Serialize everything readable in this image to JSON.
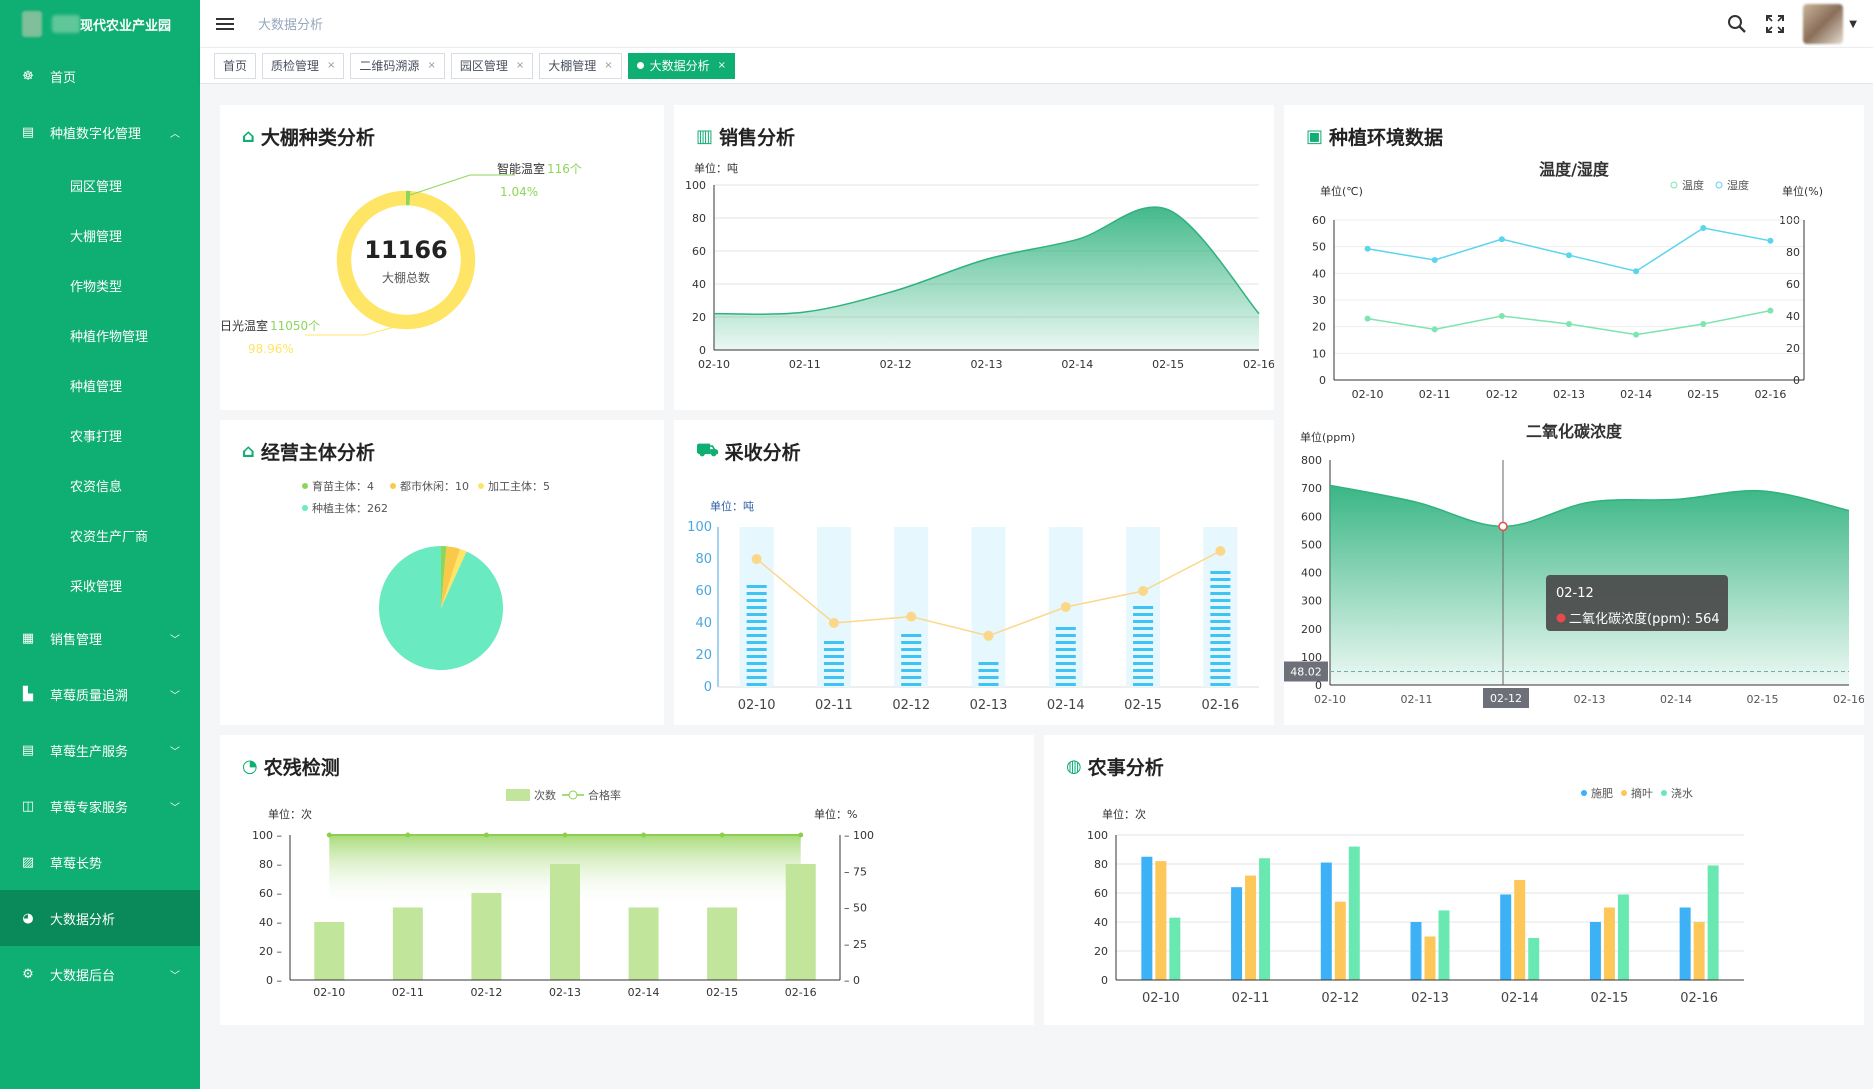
{
  "brand": {
    "name": "现代农业产业园"
  },
  "sidebar": {
    "items": [
      {
        "icon": "dashboard-icon",
        "glyph": "☸",
        "label": "首页",
        "type": "item"
      },
      {
        "icon": "grid-icon",
        "glyph": "▤",
        "label": "种植数字化管理",
        "type": "item",
        "arrow": "︿"
      },
      {
        "label": "园区管理",
        "type": "sub"
      },
      {
        "label": "大棚管理",
        "type": "sub"
      },
      {
        "label": "作物类型",
        "type": "sub"
      },
      {
        "label": "种植作物管理",
        "type": "sub"
      },
      {
        "label": "种植管理",
        "type": "sub"
      },
      {
        "label": "农事打理",
        "type": "sub"
      },
      {
        "label": "农资信息",
        "type": "sub"
      },
      {
        "label": "农资生产厂商",
        "type": "sub"
      },
      {
        "label": "采收管理",
        "type": "sub"
      },
      {
        "icon": "table-icon",
        "glyph": "▦",
        "label": "销售管理",
        "type": "item",
        "arrow": "﹀"
      },
      {
        "icon": "document-icon",
        "glyph": "▙",
        "label": "草莓质量追溯",
        "type": "item",
        "arrow": "﹀"
      },
      {
        "icon": "grid-icon",
        "glyph": "▤",
        "label": "草莓生产服务",
        "type": "item",
        "arrow": "﹀"
      },
      {
        "icon": "book-icon",
        "glyph": "◫",
        "label": "草莓专家服务",
        "type": "item",
        "arrow": "﹀"
      },
      {
        "icon": "chart-icon",
        "glyph": "▨",
        "label": "草莓长势",
        "type": "item"
      },
      {
        "icon": "globe-icon",
        "glyph": "◕",
        "label": "大数据分析",
        "type": "item",
        "active": true
      },
      {
        "icon": "gear-icon",
        "glyph": "⚙",
        "label": "大数据后台",
        "type": "item",
        "arrow": "﹀"
      }
    ]
  },
  "header": {
    "breadcrumb": "大数据分析"
  },
  "tabs": [
    {
      "label": "首页",
      "closable": false
    },
    {
      "label": "质检管理",
      "closable": true
    },
    {
      "label": "二维码溯源",
      "closable": true
    },
    {
      "label": "园区管理",
      "closable": true
    },
    {
      "label": "大棚管理",
      "closable": true
    },
    {
      "label": "大数据分析",
      "closable": true,
      "active": true
    }
  ],
  "cards": {
    "greenhouse": {
      "title": "大棚种类分析"
    },
    "sales": {
      "title": "销售分析"
    },
    "env": {
      "title": "种植环境数据"
    },
    "business": {
      "title": "经营主体分析"
    },
    "harvest": {
      "title": "采收分析"
    },
    "pesticide": {
      "title": "农残检测"
    },
    "farming": {
      "title": "农事分析"
    }
  },
  "chart_data": [
    {
      "id": "greenhouse",
      "type": "pie",
      "center_value": "11166",
      "center_label": "大棚总数",
      "slices": [
        {
          "name": "智能温室",
          "value": 116,
          "value_label": "116个",
          "percent": "1.04%",
          "color": "#8dd65a"
        },
        {
          "name": "日光温室",
          "value": 11050,
          "value_label": "11050个",
          "percent": "98.96%",
          "color": "#ffe566"
        }
      ]
    },
    {
      "id": "sales",
      "type": "area",
      "unit": "单位：吨",
      "x": [
        "02-10",
        "02-11",
        "02-12",
        "02-13",
        "02-14",
        "02-15",
        "02-16"
      ],
      "values": [
        22,
        23,
        36,
        55,
        67,
        85,
        22
      ],
      "ylim": [
        0,
        100
      ],
      "color": "#2fb27e"
    },
    {
      "id": "temp_hum",
      "type": "line",
      "title": "温度/湿度",
      "y_left_label": "单位(℃)",
      "y_right_label": "单位(%)",
      "x": [
        "02-10",
        "02-11",
        "02-12",
        "02-13",
        "02-14",
        "02-15",
        "02-16"
      ],
      "ylim_left": [
        0,
        60
      ],
      "ylim_right": [
        0,
        100
      ],
      "series": [
        {
          "name": "温度",
          "values": [
            23,
            19,
            24,
            21,
            17,
            21,
            26
          ],
          "color": "#7ee4b0",
          "axis": "left"
        },
        {
          "name": "湿度",
          "values": [
            82,
            75,
            88,
            78,
            68,
            95,
            87
          ],
          "color": "#5bd4ee",
          "axis": "right"
        }
      ]
    },
    {
      "id": "co2",
      "type": "area",
      "title": "二氧化碳浓度",
      "unit": "单位(ppm)",
      "x": [
        "02-10",
        "02-11",
        "02-12",
        "02-13",
        "02-14",
        "02-15",
        "02-16"
      ],
      "values": [
        710,
        650,
        564,
        650,
        660,
        690,
        620
      ],
      "ylim": [
        0,
        800
      ],
      "color": "#2fb27e",
      "tooltip": {
        "x": "02-12",
        "label": "二氧化碳浓度(ppm)",
        "value": "564"
      },
      "pointer_value": "48.02"
    },
    {
      "id": "business",
      "type": "pie",
      "slices": [
        {
          "name": "育苗主体",
          "value": 4,
          "color": "#8dd65a"
        },
        {
          "name": "都市休闲",
          "value": 10,
          "color": "#f9c94a"
        },
        {
          "name": "加工主体",
          "value": 5,
          "color": "#ffe566"
        },
        {
          "name": "种植主体",
          "value": 262,
          "color": "#6aeac0"
        }
      ]
    },
    {
      "id": "harvest",
      "type": "bar",
      "unit": "单位：吨",
      "categories": [
        "02-10",
        "02-11",
        "02-12",
        "02-13",
        "02-14",
        "02-15",
        "02-16"
      ],
      "ylim": [
        0,
        100
      ],
      "bars": [
        68,
        30,
        35,
        20,
        40,
        52,
        75
      ],
      "line": [
        80,
        40,
        44,
        32,
        50,
        60,
        85
      ],
      "bar_color": "#3fc3f3",
      "line_color": "#fbd889",
      "bg_color": "#e6f7fd"
    },
    {
      "id": "pesticide",
      "type": "bar",
      "unit_left": "单位：次",
      "unit_right": "单位：%",
      "categories": [
        "02-10",
        "02-11",
        "02-12",
        "02-13",
        "02-14",
        "02-15",
        "02-16"
      ],
      "ylim_left": [
        0,
        100
      ],
      "ylim_right": [
        0,
        100
      ],
      "series": [
        {
          "name": "次数",
          "values": [
            40,
            50,
            60,
            80,
            50,
            50,
            80
          ],
          "color": "#c1e59b"
        },
        {
          "name": "合格率",
          "values": [
            100,
            100,
            100,
            100,
            100,
            100,
            100
          ],
          "color": "#8ccf4d"
        }
      ]
    },
    {
      "id": "farming",
      "type": "bar",
      "unit": "单位：次",
      "categories": [
        "02-10",
        "02-11",
        "02-12",
        "02-13",
        "02-14",
        "02-15",
        "02-16"
      ],
      "ylim": [
        0,
        100
      ],
      "series": [
        {
          "name": "施肥",
          "values": [
            85,
            64,
            81,
            40,
            59,
            40,
            50
          ],
          "color": "#3cb1f6"
        },
        {
          "name": "摘叶",
          "values": [
            82,
            72,
            54,
            30,
            69,
            50,
            40
          ],
          "color": "#fdc75a"
        },
        {
          "name": "浇水",
          "values": [
            43,
            84,
            92,
            48,
            29,
            59,
            79
          ],
          "color": "#6ae8b2"
        }
      ]
    }
  ]
}
